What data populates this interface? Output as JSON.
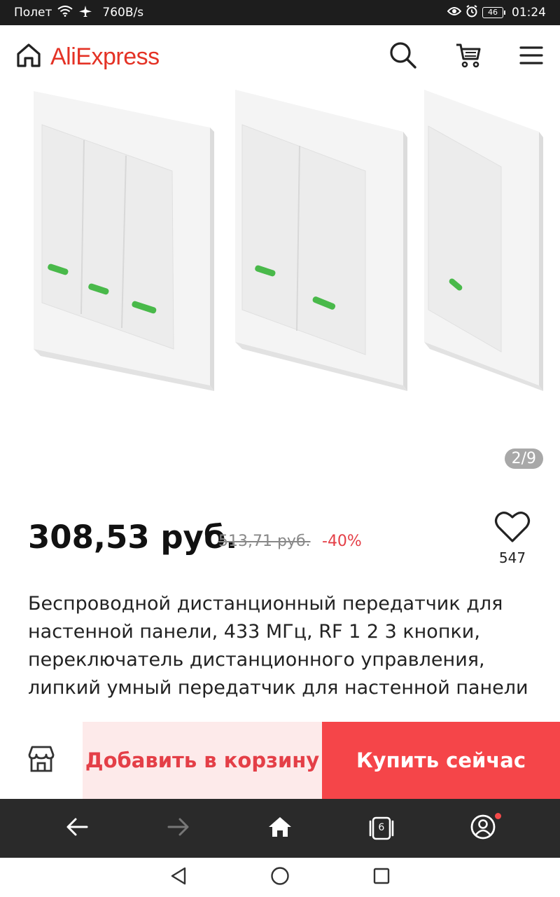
{
  "status_bar": {
    "carrier": "Полет",
    "speed": "760B/s",
    "battery": "46",
    "time": "01:24"
  },
  "header": {
    "logo_text": "AliExpress"
  },
  "gallery": {
    "counter": "2/9"
  },
  "product": {
    "price": "308,53 руб.",
    "old_price": "513,71 руб.",
    "discount": "-40%",
    "wishlist_count": "547",
    "title": "Беспроводной дистанционный передатчик для настенной панели, 433 МГц, RF 1 2 3 кнопки, переключатель дистанционного управления, липкий умный передатчик для настенной панели"
  },
  "actions": {
    "add_to_cart": "Добавить в корзину",
    "buy_now": "Купить сейчас"
  },
  "browser_nav": {
    "tabs_count": "6"
  },
  "colors": {
    "brand": "#e43225",
    "discount": "#e43f47",
    "buy_button": "#f54549",
    "cart_button_bg": "#fdeaea"
  }
}
